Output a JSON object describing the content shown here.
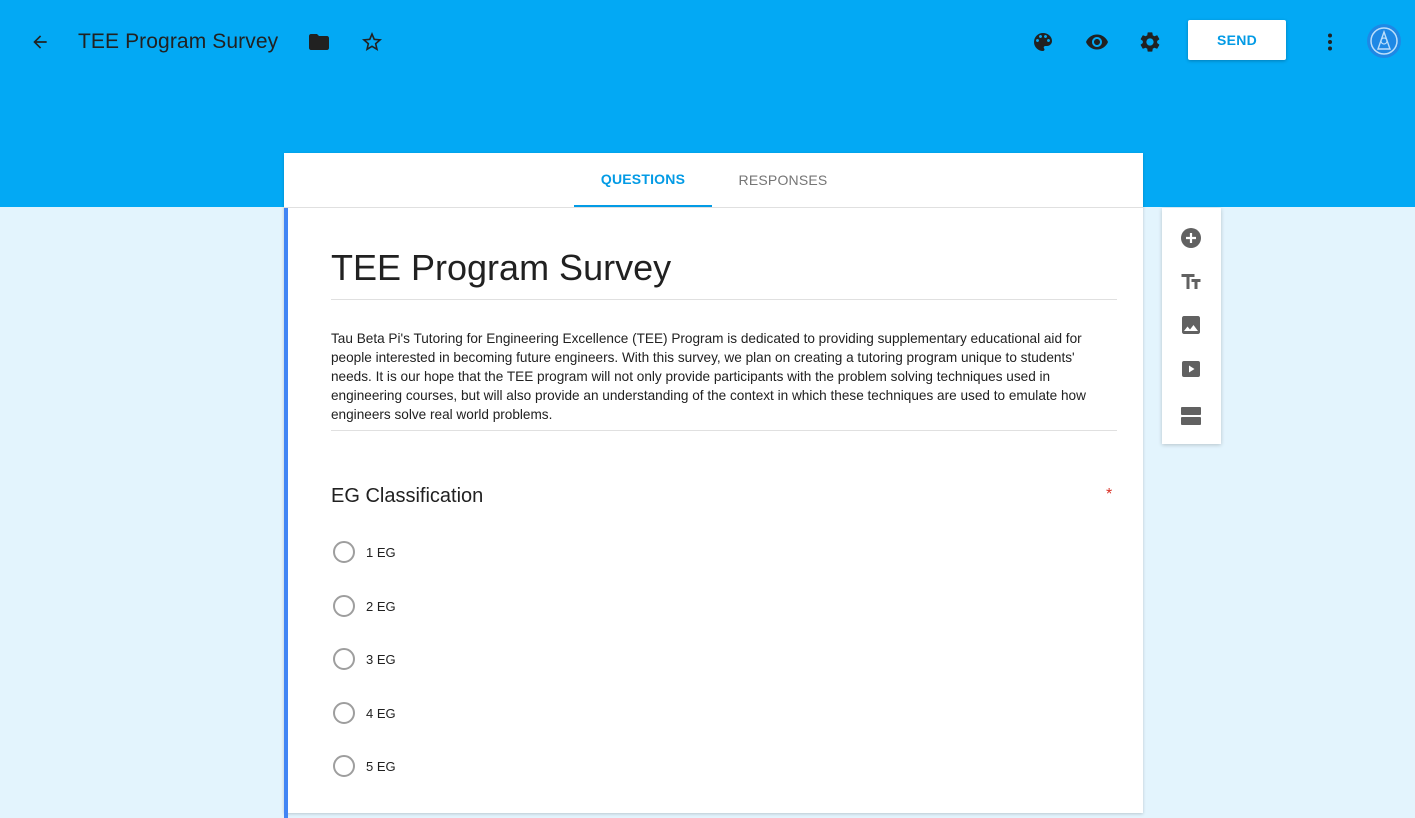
{
  "app": {
    "title": "TEE Program Survey",
    "send_label": "SEND"
  },
  "icons": {
    "back": "arrow-back-icon",
    "folder": "folder-icon",
    "star": "star-outline-icon",
    "palette": "palette-icon",
    "preview": "eye-icon",
    "settings": "gear-icon",
    "more": "more-vert-icon",
    "avatar": "avatar-icon"
  },
  "tabs": [
    {
      "label": "QUESTIONS",
      "active": true
    },
    {
      "label": "RESPONSES",
      "active": false
    }
  ],
  "form": {
    "title": "TEE Program Survey",
    "description": "Tau Beta Pi's Tutoring for Engineering Excellence (TEE) Program is dedicated to providing supplementary educational aid for people interested in becoming future engineers. With this survey, we plan on creating a tutoring program unique to students' needs. It is our hope that the TEE program will not only provide participants with the problem solving techniques used in engineering courses, but will also provide an understanding of the context in which these techniques are used to emulate how engineers solve real world problems."
  },
  "question": {
    "title": "EG Classification",
    "required_mark": "*",
    "options": [
      "1 EG",
      "2 EG",
      "3 EG",
      "4 EG",
      "5 EG"
    ]
  },
  "toolbar": {
    "items": [
      "add-question-icon",
      "add-title-icon",
      "add-image-icon",
      "add-video-icon",
      "add-section-icon"
    ]
  },
  "colors": {
    "header": "#03a9f4",
    "background": "#e3f4fd",
    "accent": "#039be5",
    "card_accent": "#4285f4",
    "required": "#d93025"
  }
}
